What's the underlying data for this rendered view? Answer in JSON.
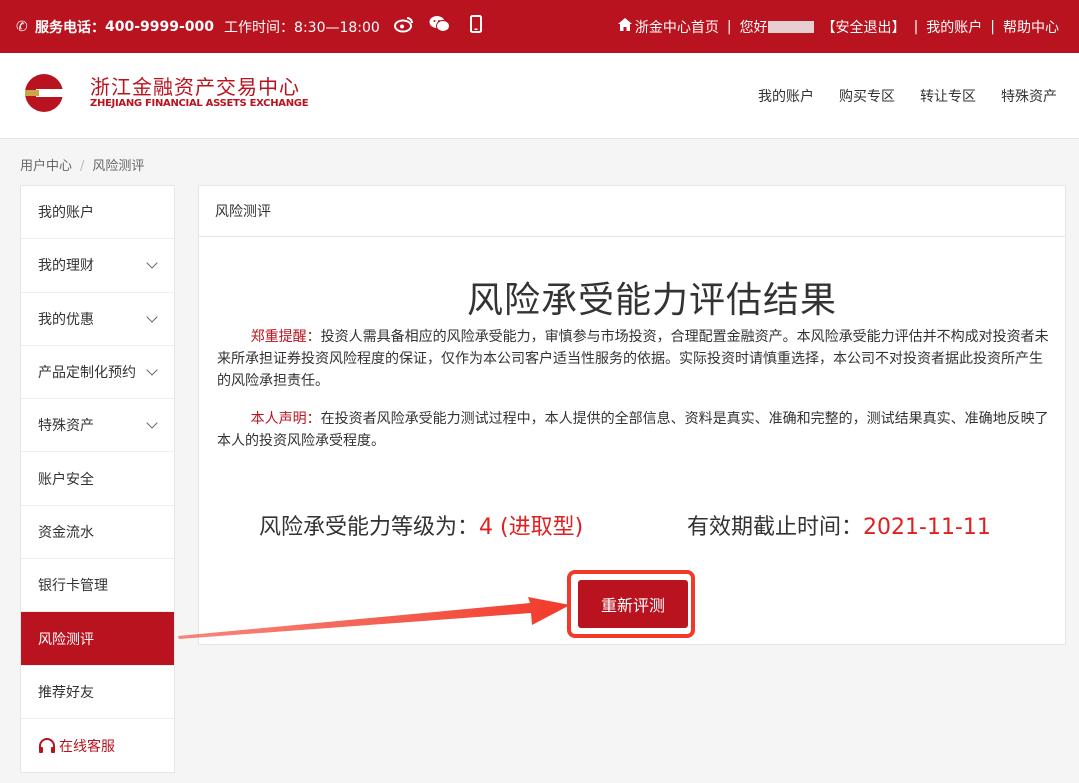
{
  "topbar": {
    "phone_label": "服务电话：",
    "phone_number": "400-9999-000",
    "worktime": "工作时间：8:30—18:00",
    "home_link": "浙金中心首页",
    "greeting": "您好",
    "logout": "【安全退出】",
    "my_account": "我的账户",
    "help": "帮助中心",
    "sep": "|"
  },
  "header": {
    "brand_cn": "浙江金融资产交易中心",
    "brand_en": "ZHEJIANG FINANCIAL ASSETS EXCHANGE",
    "nav": [
      "我的账户",
      "购买专区",
      "转让专区",
      "特殊资产"
    ]
  },
  "breadcrumb": {
    "root": "用户中心",
    "sep": "/",
    "current": "风险测评"
  },
  "sidebar": {
    "items": [
      {
        "label": "我的账户"
      },
      {
        "label": "我的理财"
      },
      {
        "label": "我的优惠"
      },
      {
        "label": "产品定制化预约"
      },
      {
        "label": "特殊资产"
      },
      {
        "label": "账户安全"
      },
      {
        "label": "资金流水"
      },
      {
        "label": "银行卡管理"
      },
      {
        "label": "风险测评"
      },
      {
        "label": "推荐好友"
      },
      {
        "label": "在线客服"
      }
    ]
  },
  "panel": {
    "header": "风险测评",
    "title": "风险承受能力评估结果",
    "notice1_label": "郑重提醒：",
    "notice1_text": "投资人需具备相应的风险承受能力，审慎参与市场投资，合理配置金融资产。本风险承受能力评估并不构成对投资者未来所承担证券投资风险程度的保证，仅作为本公司客户适当性服务的依据。实际投资时请慎重选择，本公司不对投资者据此投资所产生的风险承担责任。",
    "notice2_label": "本人声明：",
    "notice2_text": "在投资者风险承受能力测试过程中，本人提供的全部信息、资料是真实、准确和完整的，测试结果真实、准确地反映了本人的投资风险承受程度。",
    "level_label": "风险承受能力等级为：",
    "level_value": "4 (进取型)",
    "valid_label": "有效期截止时间：",
    "valid_value": "2021-11-11",
    "retest_button": "重新评测"
  },
  "colors": {
    "brand": "#b9131f",
    "highlight": "#e02020",
    "annotation": "#f23a2a"
  }
}
